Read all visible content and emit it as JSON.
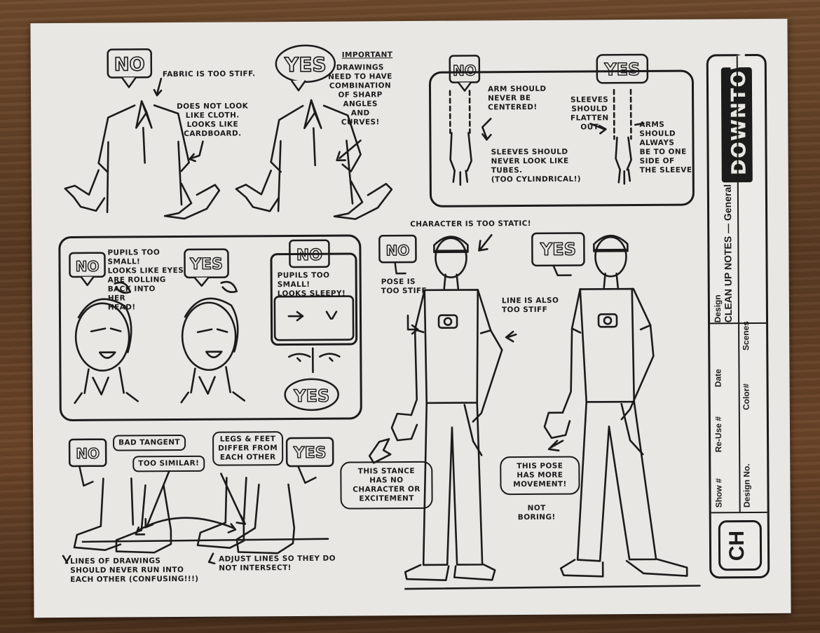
{
  "stamps": {
    "no": "NO",
    "yes": "YES"
  },
  "shirt_section": {
    "fabric_note": "FABRIC IS TOO STIFF.",
    "cloth_note": "DOES NOT LOOK\nLIKE CLOTH.\nLOOKS LIKE\nCARDBOARD.",
    "important_label": "IMPORTANT",
    "important_note": "DRAWINGS\nNEED TO HAVE\nCOMBINATION\nOF SHARP\nANGLES\nAND\nCURVES!"
  },
  "sleeve_section": {
    "arm_note": "ARM SHOULD\nNEVER BE\nCENTERED!",
    "tube_note": "SLEEVES SHOULD\nNEVER LOOK LIKE\nTUBES.\n(TOO CYLINDRICAL!)",
    "flatten_note": "SLEEVES\nSHOULD\nFLATTEN\nOUT",
    "side_note": "ARMS\nSHOULD\nALWAYS\nBE TO ONE\nSIDE OF\nTHE SLEEVE"
  },
  "face_section": {
    "pupils_note": "PUPILS TOO\nSMALL!\nLOOKS LIKE EYES\nARE ROLLING\nBACK INTO\nHER\nHEAD!",
    "sleepy_note": "PUPILS TOO\nSMALL!\nLOOKS SLEEPY!"
  },
  "feet_section": {
    "bad_tangent": "BAD TANGENT",
    "too_similar": "TOO SIMILAR!",
    "legs_note": "LEGS & FEET\nDIFFER FROM\nEACH OTHER",
    "lines_note": "LINES OF DRAWINGS\nSHOULD NEVER RUN INTO\nEACH OTHER (CONFUSING!!!)",
    "adjust_note": "ADJUST LINES SO THEY DO\nNOT INTERSECT!"
  },
  "pose_section": {
    "static_note": "CHARACTER IS TOO STATIC!",
    "pose_stiff": "POSE IS\nTOO STIFF",
    "line_stiff": "LINE IS ALSO\nTOO STIFF",
    "stance_note": "THIS STANCE\nHAS NO\nCHARACTER OR\nEXCITEMENT",
    "movement_note": "THIS POSE\nHAS MORE\nMOVEMENT!",
    "not_boring": "NOT\nBORING!"
  },
  "title_block": {
    "brand": "DOWNTOWN",
    "design_label": "Design",
    "design_value": "CLEAN UP NOTES — General",
    "show_label": "Show #",
    "reuse_label": "Re-Use #",
    "date_label": "Date",
    "design_no_label": "Design No.",
    "color_label": "Color#",
    "scenes_label": "Scenes",
    "show_code": "CH"
  }
}
